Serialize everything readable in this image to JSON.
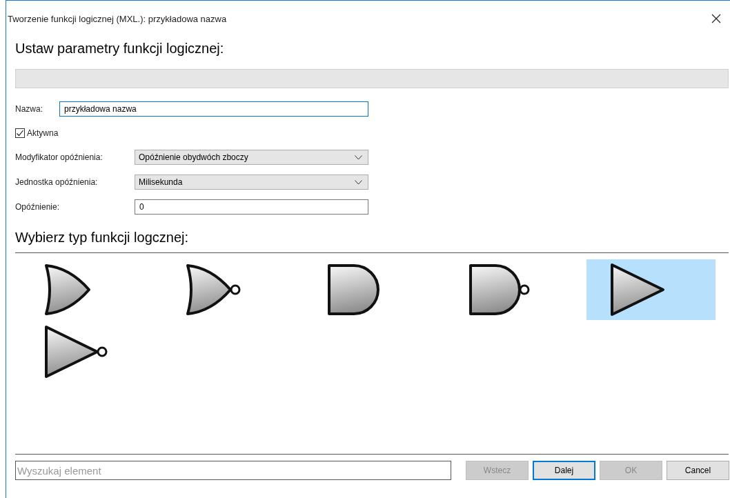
{
  "window": {
    "title": "Tworzenie funkcji logicznej (MXL.): przykładowa nazwa"
  },
  "heading": "Ustaw parametry funkcji logicznej:",
  "name_field": {
    "label": "Nazwa:",
    "value": "przykładowa nazwa"
  },
  "active": {
    "label": "Aktywna",
    "checked": true
  },
  "fields": [
    {
      "kind": "dropdown",
      "label": "Modyfikator opóźnienia:",
      "value": "Opóźnienie obydwóch zboczy"
    },
    {
      "kind": "dropdown",
      "label": "Jednostka opóźnienia:",
      "value": "Milisekunda"
    },
    {
      "kind": "text",
      "label": "Opóźnienie:",
      "value": "0"
    }
  ],
  "gate_heading": "Wybierz typ funkcji logcznej:",
  "gates": [
    {
      "kind": "or",
      "selected": false
    },
    {
      "kind": "nor",
      "selected": false
    },
    {
      "kind": "and",
      "selected": false
    },
    {
      "kind": "nand",
      "selected": false
    },
    {
      "kind": "buffer",
      "selected": true
    },
    {
      "kind": "not",
      "selected": false
    }
  ],
  "search": {
    "placeholder": "Wyszukaj element"
  },
  "buttons": [
    {
      "label": "Wstecz",
      "disabled": true,
      "default": false
    },
    {
      "label": "Dalej",
      "disabled": false,
      "default": true
    },
    {
      "label": "OK",
      "disabled": true,
      "default": false
    },
    {
      "label": "Cancel",
      "disabled": false,
      "default": false
    }
  ]
}
